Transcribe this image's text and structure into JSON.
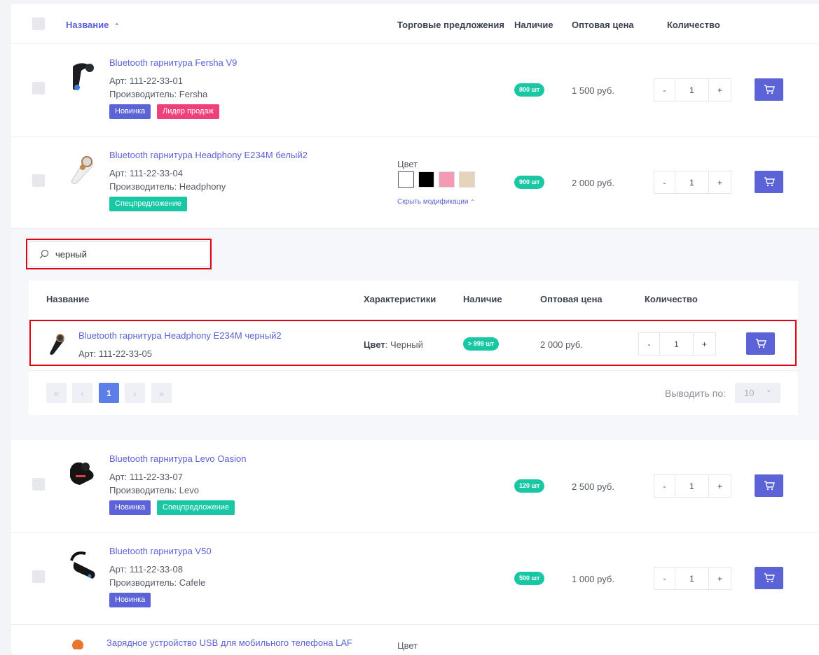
{
  "header": {
    "name": "Название",
    "offers": "Торговые предложения",
    "stock": "Наличие",
    "price": "Оптовая цена",
    "qty": "Количество"
  },
  "products": [
    {
      "name": "Bluetooth гарнитура Fersha V9",
      "art": "Арт: 111-22-33-01",
      "maker": "Производитель: Fersha",
      "badges": [
        "Новинка",
        "Лидер продаж"
      ],
      "stock": "800 шт",
      "price": "1 500 руб.",
      "qty": "1"
    },
    {
      "name": "Bluetooth гарнитура Headphony E234M белый2",
      "art": "Арт: 111-22-33-04",
      "maker": "Производитель: Headphony",
      "badges": [
        "Спецпредложение"
      ],
      "stock": "900 шт",
      "price": "2 000 руб.",
      "qty": "1",
      "color_label": "Цвет",
      "hide_mods": "Скрыть модификации"
    },
    {
      "name": "Bluetooth гарнитура Levo Oasion",
      "art": "Арт: 111-22-33-07",
      "maker": "Производитель: Levo",
      "badges": [
        "Новинка",
        "Спецпредложение"
      ],
      "stock": "120 шт",
      "price": "2 500 руб.",
      "qty": "1"
    },
    {
      "name": "Bluetooth гарнитура V50",
      "art": "Арт: 111-22-33-08",
      "maker": "Производитель: Cafele",
      "badges": [
        "Новинка"
      ],
      "stock": "500 шт",
      "price": "1 000 руб.",
      "qty": "1"
    },
    {
      "name": "Зарядное устройство USB для мобильного телефона LAF",
      "color_label": "Цвет"
    }
  ],
  "search": {
    "value": "черный"
  },
  "sub": {
    "header": {
      "name": "Название",
      "chars": "Характеристики",
      "stock": "Наличие",
      "price": "Оптовая цена",
      "qty": "Количество"
    },
    "row": {
      "name": "Bluetooth гарнитура Headphony E234M черный2",
      "art": "Арт: 111-22-33-05",
      "char_key": "Цвет",
      "char_val": ": Черный",
      "stock": "> 999 шт",
      "price": "2 000 руб.",
      "qty": "1"
    },
    "pager": {
      "first": "«",
      "prev": "‹",
      "page": "1",
      "next": "›",
      "last": "»"
    },
    "per_page_label": "Выводить по:",
    "per_page_value": "10"
  },
  "qty_minus": "-",
  "qty_plus": "+",
  "colors": {
    "accent": "#5b63d6",
    "teal": "#1ac7a5",
    "pink": "#f0407a",
    "highlight": "#e00010"
  },
  "swatches": [
    "#ffffff",
    "#000000",
    "#f59ab5",
    "#e6d3bb"
  ]
}
